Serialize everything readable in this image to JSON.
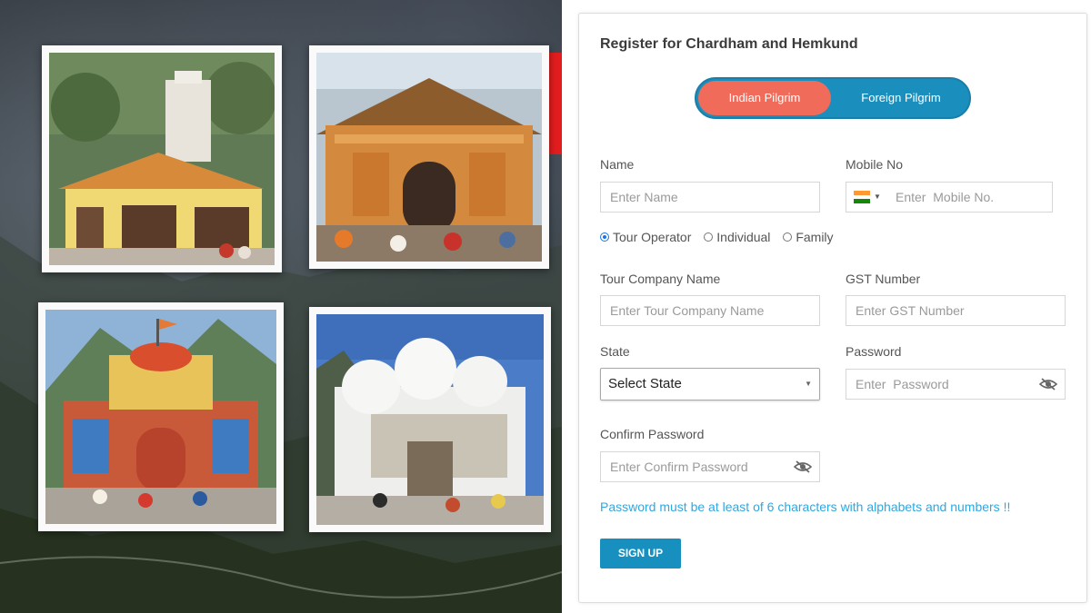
{
  "form": {
    "title": "Register for Chardham and Hemkund",
    "toggle": {
      "indian": "Indian Pilgrim",
      "foreign": "Foreign Pilgrim",
      "active": "Indian Pilgrim"
    },
    "name": {
      "label": "Name",
      "placeholder": "Enter Name"
    },
    "mobile": {
      "label": "Mobile No",
      "placeholder": "Enter  Mobile No.",
      "country_flag": "india-flag-icon"
    },
    "type_options": [
      {
        "label": "Tour Operator",
        "selected": true
      },
      {
        "label": "Individual",
        "selected": false
      },
      {
        "label": "Family",
        "selected": false
      }
    ],
    "company": {
      "label": "Tour Company Name",
      "placeholder": "Enter Tour Company Name"
    },
    "gst": {
      "label": "GST Number",
      "placeholder": "Enter GST Number"
    },
    "state": {
      "label": "State",
      "value": "Select State"
    },
    "password": {
      "label": "Password",
      "placeholder": "Enter  Password"
    },
    "confirm": {
      "label": "Confirm Password",
      "placeholder": "Enter Confirm Password"
    },
    "hint": "Password must be at least of 6 characters with alphabets and numbers !!",
    "submit": "SIGN UP"
  },
  "colors": {
    "toggle_active": "#f16b5a",
    "toggle_bg": "#1a8fbd",
    "accent": "#1790c0",
    "hint": "#2fa8e0",
    "red_strip": "#e31d1d"
  },
  "photos": [
    "temple-photo-1",
    "temple-photo-2",
    "temple-photo-3",
    "temple-photo-4"
  ]
}
